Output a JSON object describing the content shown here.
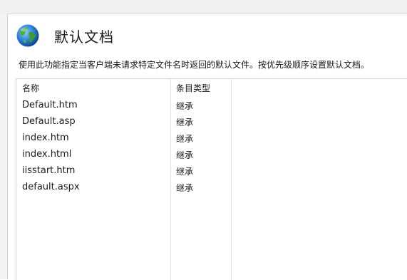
{
  "header": {
    "title": "默认文档",
    "icon": "globe-icon"
  },
  "description": "使用此功能指定当客户端未请求特定文件名时返回的默认文件。按优先级顺序设置默认文档。",
  "table": {
    "columns": [
      "名称",
      "条目类型"
    ],
    "rows": [
      {
        "name": "Default.htm",
        "type": "继承"
      },
      {
        "name": "Default.asp",
        "type": "继承"
      },
      {
        "name": "index.htm",
        "type": "继承"
      },
      {
        "name": "index.html",
        "type": "继承"
      },
      {
        "name": "iisstart.htm",
        "type": "继承"
      },
      {
        "name": "default.aspx",
        "type": "继承"
      }
    ]
  }
}
